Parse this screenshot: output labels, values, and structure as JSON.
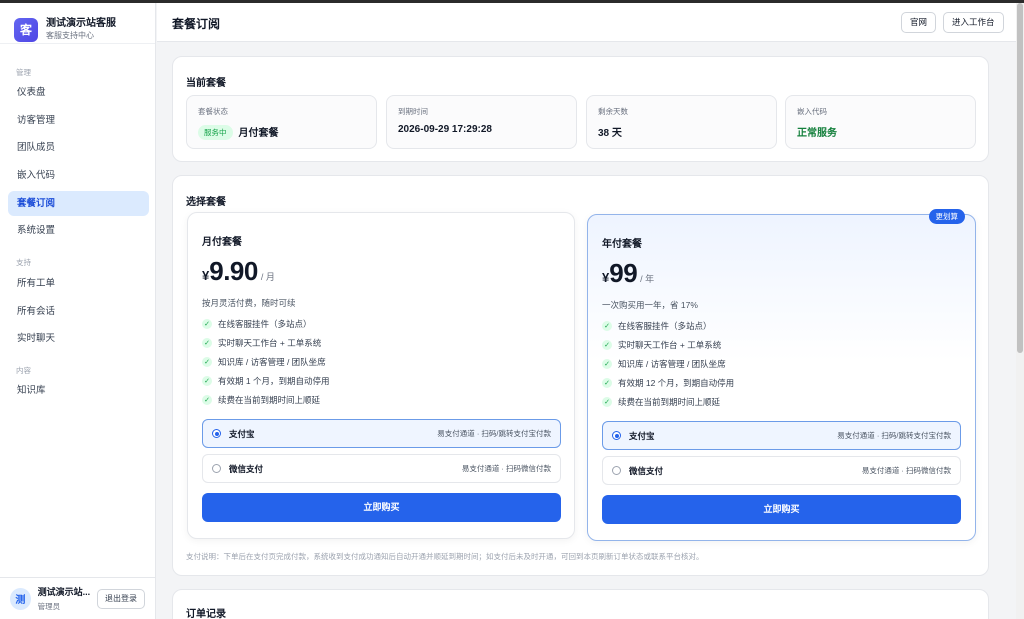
{
  "brand": {
    "logo": "客",
    "name": "测试演示站客服",
    "subtitle": "客服支持中心"
  },
  "sidebar": {
    "sections": [
      {
        "label": "管理"
      },
      {
        "label": "支持"
      },
      {
        "label": "内容"
      }
    ],
    "items": [
      {
        "label": "仪表盘"
      },
      {
        "label": "访客管理"
      },
      {
        "label": "团队成员"
      },
      {
        "label": "嵌入代码"
      },
      {
        "label": "套餐订阅",
        "active": true
      },
      {
        "label": "系统设置"
      },
      {
        "label": "所有工单"
      },
      {
        "label": "所有会话"
      },
      {
        "label": "实时聊天"
      },
      {
        "label": "知识库"
      }
    ]
  },
  "user": {
    "avatar": "测",
    "name": "测试演示站...",
    "role": "管理员",
    "logout_label": "退出登录"
  },
  "header": {
    "title": "套餐订阅",
    "site_label": "官网",
    "workspace_label": "进入工作台"
  },
  "current": {
    "title": "当前套餐",
    "stats": [
      {
        "label": "套餐状态",
        "badge": "服务中",
        "value": "月付套餐"
      },
      {
        "label": "到期时间",
        "value": "2026-09-29 17:29:28"
      },
      {
        "label": "剩余天数",
        "value": "38 天"
      },
      {
        "label": "嵌入代码",
        "value": "正常服务"
      }
    ]
  },
  "choose": {
    "title": "选择套餐",
    "plans": [
      {
        "name": "月付套餐",
        "currency": "¥",
        "price": "9.90",
        "unit": "/ 月",
        "desc": "按月灵活付费，随时可续",
        "features": [
          "在线客服挂件（多站点）",
          "实时聊天工作台 + 工单系统",
          "知识库 / 访客管理 / 团队坐席",
          "有效期 1 个月，到期自动停用",
          "续费在当前到期时间上顺延"
        ],
        "payments": [
          {
            "name": "支付宝",
            "desc": "易支付通道 · 扫码/跳转支付宝付款",
            "selected": true
          },
          {
            "name": "微信支付",
            "desc": "易支付通道 · 扫码微信付款",
            "selected": false
          }
        ],
        "buy_label": "立即购买"
      },
      {
        "name": "年付套餐",
        "ribbon": "更划算",
        "currency": "¥",
        "price": "99",
        "unit": "/ 年",
        "desc": "一次购买用一年，省 17%",
        "features": [
          "在线客服挂件（多站点）",
          "实时聊天工作台 + 工单系统",
          "知识库 / 访客管理 / 团队坐席",
          "有效期 12 个月，到期自动停用",
          "续费在当前到期时间上顺延"
        ],
        "payments": [
          {
            "name": "支付宝",
            "desc": "易支付通道 · 扫码/跳转支付宝付款",
            "selected": true
          },
          {
            "name": "微信支付",
            "desc": "易支付通道 · 扫码微信付款",
            "selected": false
          }
        ],
        "buy_label": "立即购买"
      }
    ],
    "note": "支付说明：下单后在支付页完成付款，系统收到支付成功通知后自动开通并顺延到期时间；如支付后未及时开通，可回到本页刷新订单状态或联系平台核对。"
  },
  "orders": {
    "title": "订单记录"
  },
  "icons": {
    "check": "check-icon",
    "radio": "radio-icon"
  },
  "colors": {
    "accent": "#2563eb",
    "success": "#16a34a",
    "active_nav_bg": "#dbeafe"
  }
}
